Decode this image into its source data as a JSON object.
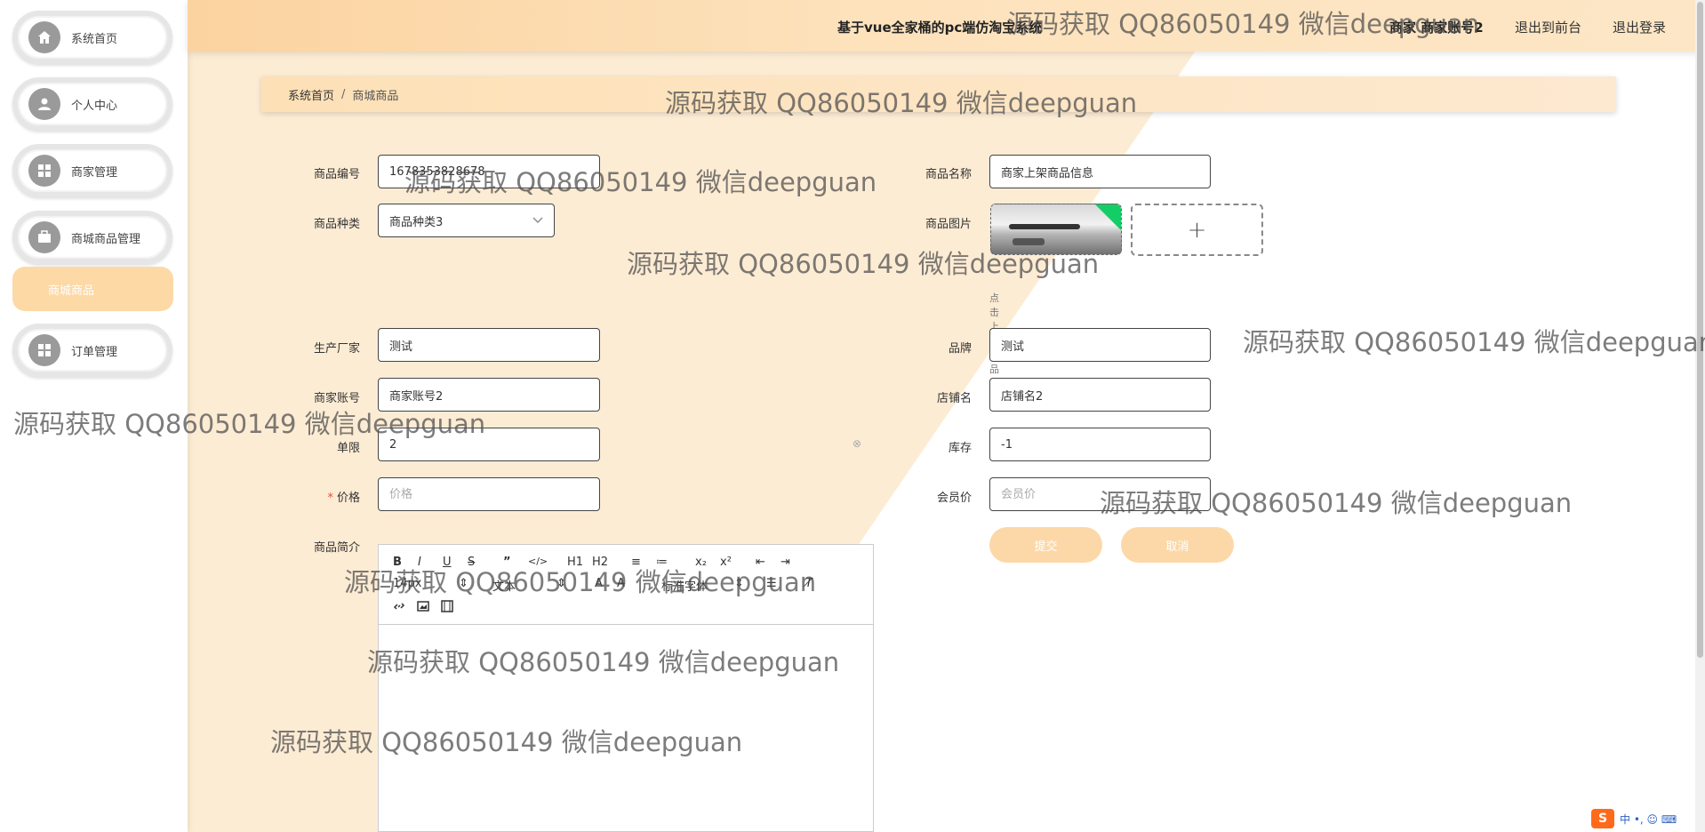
{
  "app": {
    "title": "基于vue全家桶的pc端仿淘宝系统",
    "account": "商家 商家账号2",
    "links": [
      "退出到前台",
      "退出登录"
    ]
  },
  "sidebar": {
    "items": [
      {
        "label": "系统首页",
        "icon": "home-icon"
      },
      {
        "label": "个人中心",
        "icon": "user-icon"
      },
      {
        "label": "商家管理",
        "icon": "grid-icon"
      },
      {
        "label": "商城商品管理",
        "icon": "briefcase-icon"
      },
      {
        "label": "订单管理",
        "icon": "grid-icon"
      }
    ],
    "active_sub": "商城商品"
  },
  "breadcrumb": {
    "home": "系统首页",
    "sep": "/",
    "current": "商城商品"
  },
  "form": {
    "code": {
      "label": "商品编号",
      "value": "1678353828678"
    },
    "name": {
      "label": "商品名称",
      "value": "商家上架商品信息"
    },
    "category": {
      "label": "商品种类",
      "value": "商品种类3"
    },
    "image": {
      "label": "商品图片",
      "hint": "点击上传商品图片"
    },
    "maker": {
      "label": "生产厂家",
      "value": "测试"
    },
    "brand": {
      "label": "品牌",
      "value": "测试"
    },
    "merchant": {
      "label": "商家账号",
      "value": "商家账号2"
    },
    "shop": {
      "label": "店铺名",
      "value": "店铺名2"
    },
    "limit": {
      "label": "单限",
      "value": "2"
    },
    "stock": {
      "label": "库存",
      "value": "-1"
    },
    "price": {
      "label": "价格",
      "required_mark": "*",
      "placeholder": "价格"
    },
    "vip_price": {
      "label": "会员价",
      "placeholder": "会员价"
    },
    "intro": {
      "label": "商品简介"
    },
    "submit": "提交",
    "cancel": "取消"
  },
  "editor": {
    "toolbar_row1": [
      "B",
      "I",
      "U",
      "S",
      "”",
      "</>",
      "H1",
      "H2",
      "≡",
      "≔",
      "x₂",
      "x²",
      "⇤",
      "⇥"
    ],
    "size_label": "14px",
    "font_label": "文本",
    "heading_label": "标准字体"
  },
  "watermark": "源码获取 QQ86050149 微信deepguan",
  "ime": {
    "logo": "S",
    "text": "中 •, ☺ ⌨"
  }
}
